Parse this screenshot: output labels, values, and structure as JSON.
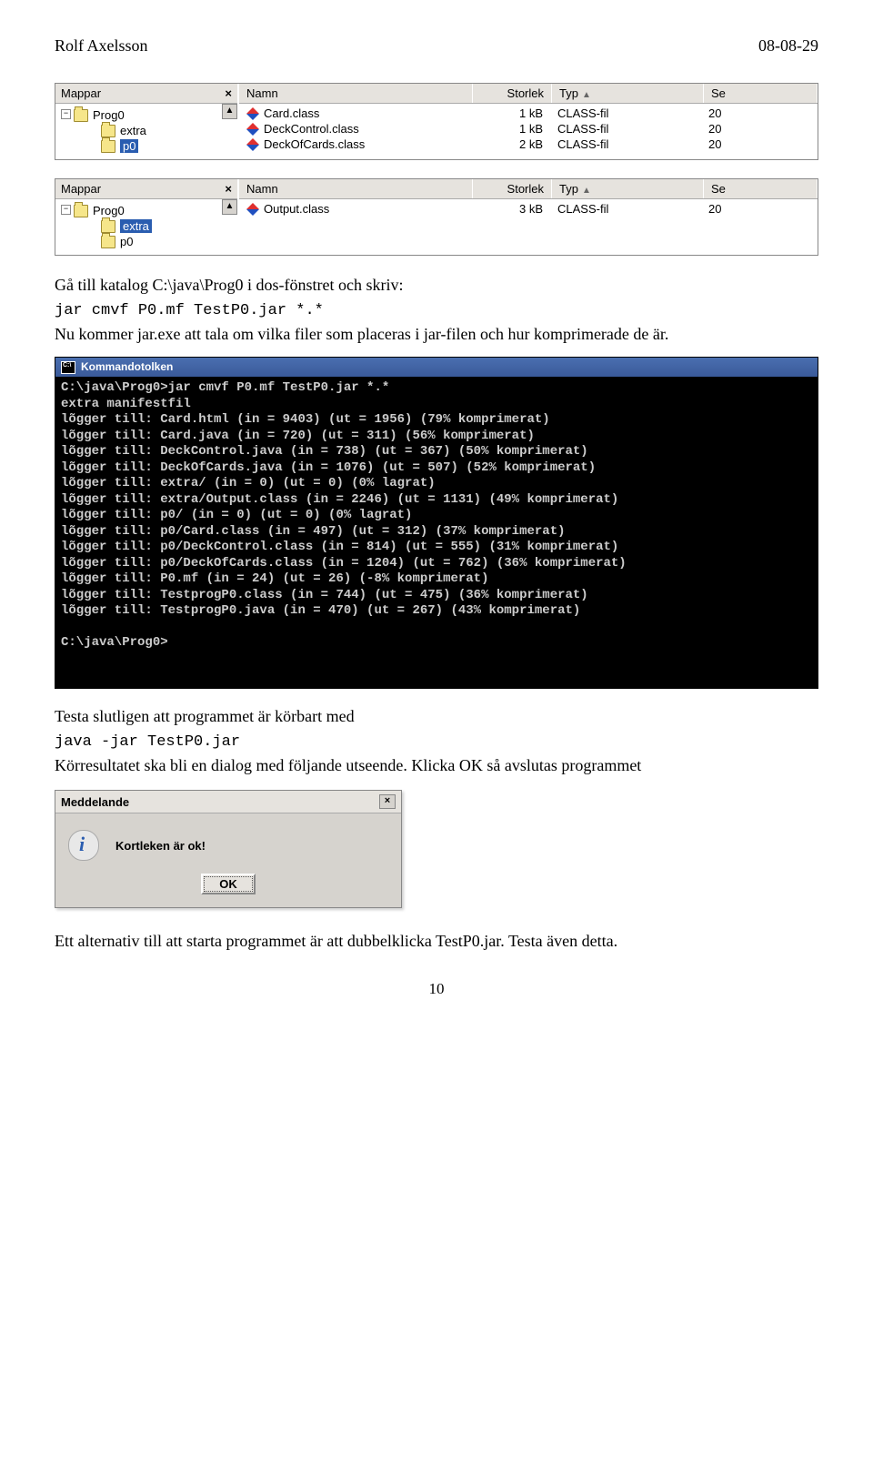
{
  "header": {
    "author": "Rolf Axelsson",
    "date": "08-08-29"
  },
  "explorer1": {
    "tree_label": "Mappar",
    "tree": [
      {
        "label": "Prog0",
        "indent": 1,
        "selected": false,
        "expand": true
      },
      {
        "label": "extra",
        "indent": 2,
        "selected": false,
        "expand": false
      },
      {
        "label": "p0",
        "indent": 2,
        "selected": true,
        "expand": false
      }
    ],
    "columns": {
      "name": "Namn",
      "size": "Storlek",
      "type": "Typ",
      "date": "Se"
    },
    "rows": [
      {
        "name": "Card.class",
        "size": "1 kB",
        "type": "CLASS-fil",
        "date": "20"
      },
      {
        "name": "DeckControl.class",
        "size": "1 kB",
        "type": "CLASS-fil",
        "date": "20"
      },
      {
        "name": "DeckOfCards.class",
        "size": "2 kB",
        "type": "CLASS-fil",
        "date": "20"
      }
    ]
  },
  "explorer2": {
    "tree_label": "Mappar",
    "tree": [
      {
        "label": "Prog0",
        "indent": 1,
        "selected": false,
        "expand": true
      },
      {
        "label": "extra",
        "indent": 2,
        "selected": true,
        "expand": false
      },
      {
        "label": "p0",
        "indent": 2,
        "selected": false,
        "expand": false
      }
    ],
    "columns": {
      "name": "Namn",
      "size": "Storlek",
      "type": "Typ",
      "date": "Se"
    },
    "rows": [
      {
        "name": "Output.class",
        "size": "3 kB",
        "type": "CLASS-fil",
        "date": "20"
      }
    ]
  },
  "para1": {
    "line1": "Gå till katalog C:\\java\\Prog0 i dos-fönstret och skriv:",
    "code": "jar cmvf P0.mf TestP0.jar *.*",
    "line2": "Nu kommer jar.exe att tala om vilka filer som placeras i jar-filen och hur komprimerade de är."
  },
  "terminal": {
    "title": "Kommandotolken",
    "lines": [
      "C:\\java\\Prog0>jar cmvf P0.mf TestP0.jar *.*",
      "extra manifestfil",
      "lõgger till: Card.html (in = 9403) (ut = 1956) (79% komprimerat)",
      "lõgger till: Card.java (in = 720) (ut = 311) (56% komprimerat)",
      "lõgger till: DeckControl.java (in = 738) (ut = 367) (50% komprimerat)",
      "lõgger till: DeckOfCards.java (in = 1076) (ut = 507) (52% komprimerat)",
      "lõgger till: extra/ (in = 0) (ut = 0) (0% lagrat)",
      "lõgger till: extra/Output.class (in = 2246) (ut = 1131) (49% komprimerat)",
      "lõgger till: p0/ (in = 0) (ut = 0) (0% lagrat)",
      "lõgger till: p0/Card.class (in = 497) (ut = 312) (37% komprimerat)",
      "lõgger till: p0/DeckControl.class (in = 814) (ut = 555) (31% komprimerat)",
      "lõgger till: p0/DeckOfCards.class (in = 1204) (ut = 762) (36% komprimerat)",
      "lõgger till: P0.mf (in = 24) (ut = 26) (-8% komprimerat)",
      "lõgger till: TestprogP0.class (in = 744) (ut = 475) (36% komprimerat)",
      "lõgger till: TestprogP0.java (in = 470) (ut = 267) (43% komprimerat)",
      "",
      "C:\\java\\Prog0>"
    ]
  },
  "para2": {
    "line1": "Testa slutligen att programmet är körbart med",
    "code": "java -jar TestP0.jar",
    "line2": "Körresultatet ska bli en dialog med följande utseende. Klicka OK så avslutas programmet"
  },
  "dialog": {
    "title": "Meddelande",
    "message": "Kortleken är ok!",
    "ok": "OK"
  },
  "para3": "Ett alternativ till att starta programmet är att dubbelklicka TestP0.jar. Testa även detta.",
  "page_number": "10"
}
